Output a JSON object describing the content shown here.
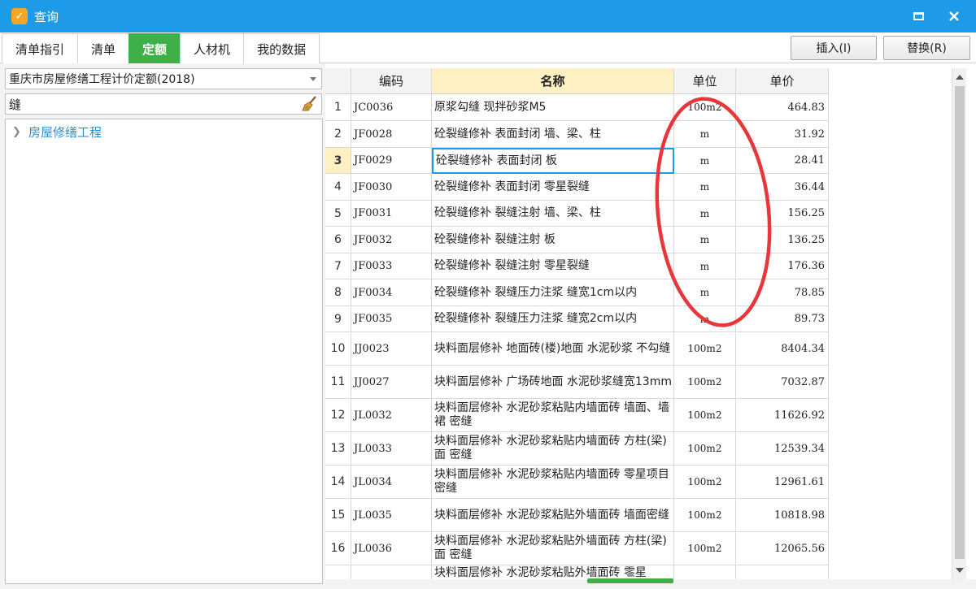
{
  "window": {
    "title": "查询",
    "icon": "app-logo-icon"
  },
  "tabs": [
    "清单指引",
    "清单",
    "定额",
    "人材机",
    "我的数据"
  ],
  "active_tab": "定额",
  "actions": {
    "insert": "插入(I)",
    "replace": "替换(R)"
  },
  "left_panel": {
    "library": "重庆市房屋修缮工程计价定额(2018)",
    "search_value": "缝",
    "tree_root": "房屋修缮工程"
  },
  "table": {
    "headers": [
      "编码",
      "名称",
      "单位",
      "单价"
    ],
    "rows": [
      {
        "idx": "1",
        "code": "JC0036",
        "name": "原浆勾缝 现拌砂浆M5",
        "unit": "100m2",
        "price": "464.83"
      },
      {
        "idx": "2",
        "code": "JF0028",
        "name": "砼裂缝修补 表面封闭 墙、梁、柱",
        "unit": "m",
        "price": "31.92"
      },
      {
        "idx": "3",
        "code": "JF0029",
        "name": "砼裂缝修补 表面封闭 板",
        "unit": "m",
        "price": "28.41"
      },
      {
        "idx": "4",
        "code": "JF0030",
        "name": "砼裂缝修补 表面封闭 零星裂缝",
        "unit": "m",
        "price": "36.44"
      },
      {
        "idx": "5",
        "code": "JF0031",
        "name": "砼裂缝修补 裂缝注射 墙、梁、柱",
        "unit": "m",
        "price": "156.25"
      },
      {
        "idx": "6",
        "code": "JF0032",
        "name": "砼裂缝修补 裂缝注射 板",
        "unit": "m",
        "price": "136.25"
      },
      {
        "idx": "7",
        "code": "JF0033",
        "name": "砼裂缝修补 裂缝注射 零星裂缝",
        "unit": "m",
        "price": "176.36"
      },
      {
        "idx": "8",
        "code": "JF0034",
        "name": "砼裂缝修补 裂缝压力注浆 缝宽1cm以内",
        "unit": "m",
        "price": "78.85"
      },
      {
        "idx": "9",
        "code": "JF0035",
        "name": "砼裂缝修补 裂缝压力注浆 缝宽2cm以内",
        "unit": "m",
        "price": "89.73"
      },
      {
        "idx": "10",
        "code": "JJ0023",
        "name": "块料面层修补 地面砖(楼)地面 水泥砂浆 不勾缝",
        "unit": "100m2",
        "price": "8404.34"
      },
      {
        "idx": "11",
        "code": "JJ0027",
        "name": "块料面层修补 广场砖地面 水泥砂浆缝宽13mm",
        "unit": "100m2",
        "price": "7032.87"
      },
      {
        "idx": "12",
        "code": "JL0032",
        "name": "块料面层修补 水泥砂浆粘贴内墙面砖 墙面、墙裙 密缝",
        "unit": "100m2",
        "price": "11626.92"
      },
      {
        "idx": "13",
        "code": "JL0033",
        "name": "块料面层修补 水泥砂浆粘贴内墙面砖 方柱(梁)面 密缝",
        "unit": "100m2",
        "price": "12539.34"
      },
      {
        "idx": "14",
        "code": "JL0034",
        "name": "块料面层修补 水泥砂浆粘贴内墙面砖 零星项目 密缝",
        "unit": "100m2",
        "price": "12961.61"
      },
      {
        "idx": "15",
        "code": "JL0035",
        "name": "块料面层修补 水泥砂浆粘贴外墙面砖 墙面密缝",
        "unit": "100m2",
        "price": "10818.98"
      },
      {
        "idx": "16",
        "code": "JL0036",
        "name": "块料面层修补 水泥砂浆粘贴外墙面砖 方柱(梁)面 密缝",
        "unit": "100m2",
        "price": "12065.56"
      },
      {
        "idx": "",
        "code": "",
        "name": "块料面层修补 水泥砂浆粘贴外墙面砖 零星",
        "unit": "",
        "price": ""
      }
    ],
    "selected_row": "3"
  },
  "colors": {
    "titlebar": "#1e9be8",
    "active_tab": "#3fb049",
    "highlight": "#fdf1c4",
    "annotation": "#e8373b"
  }
}
